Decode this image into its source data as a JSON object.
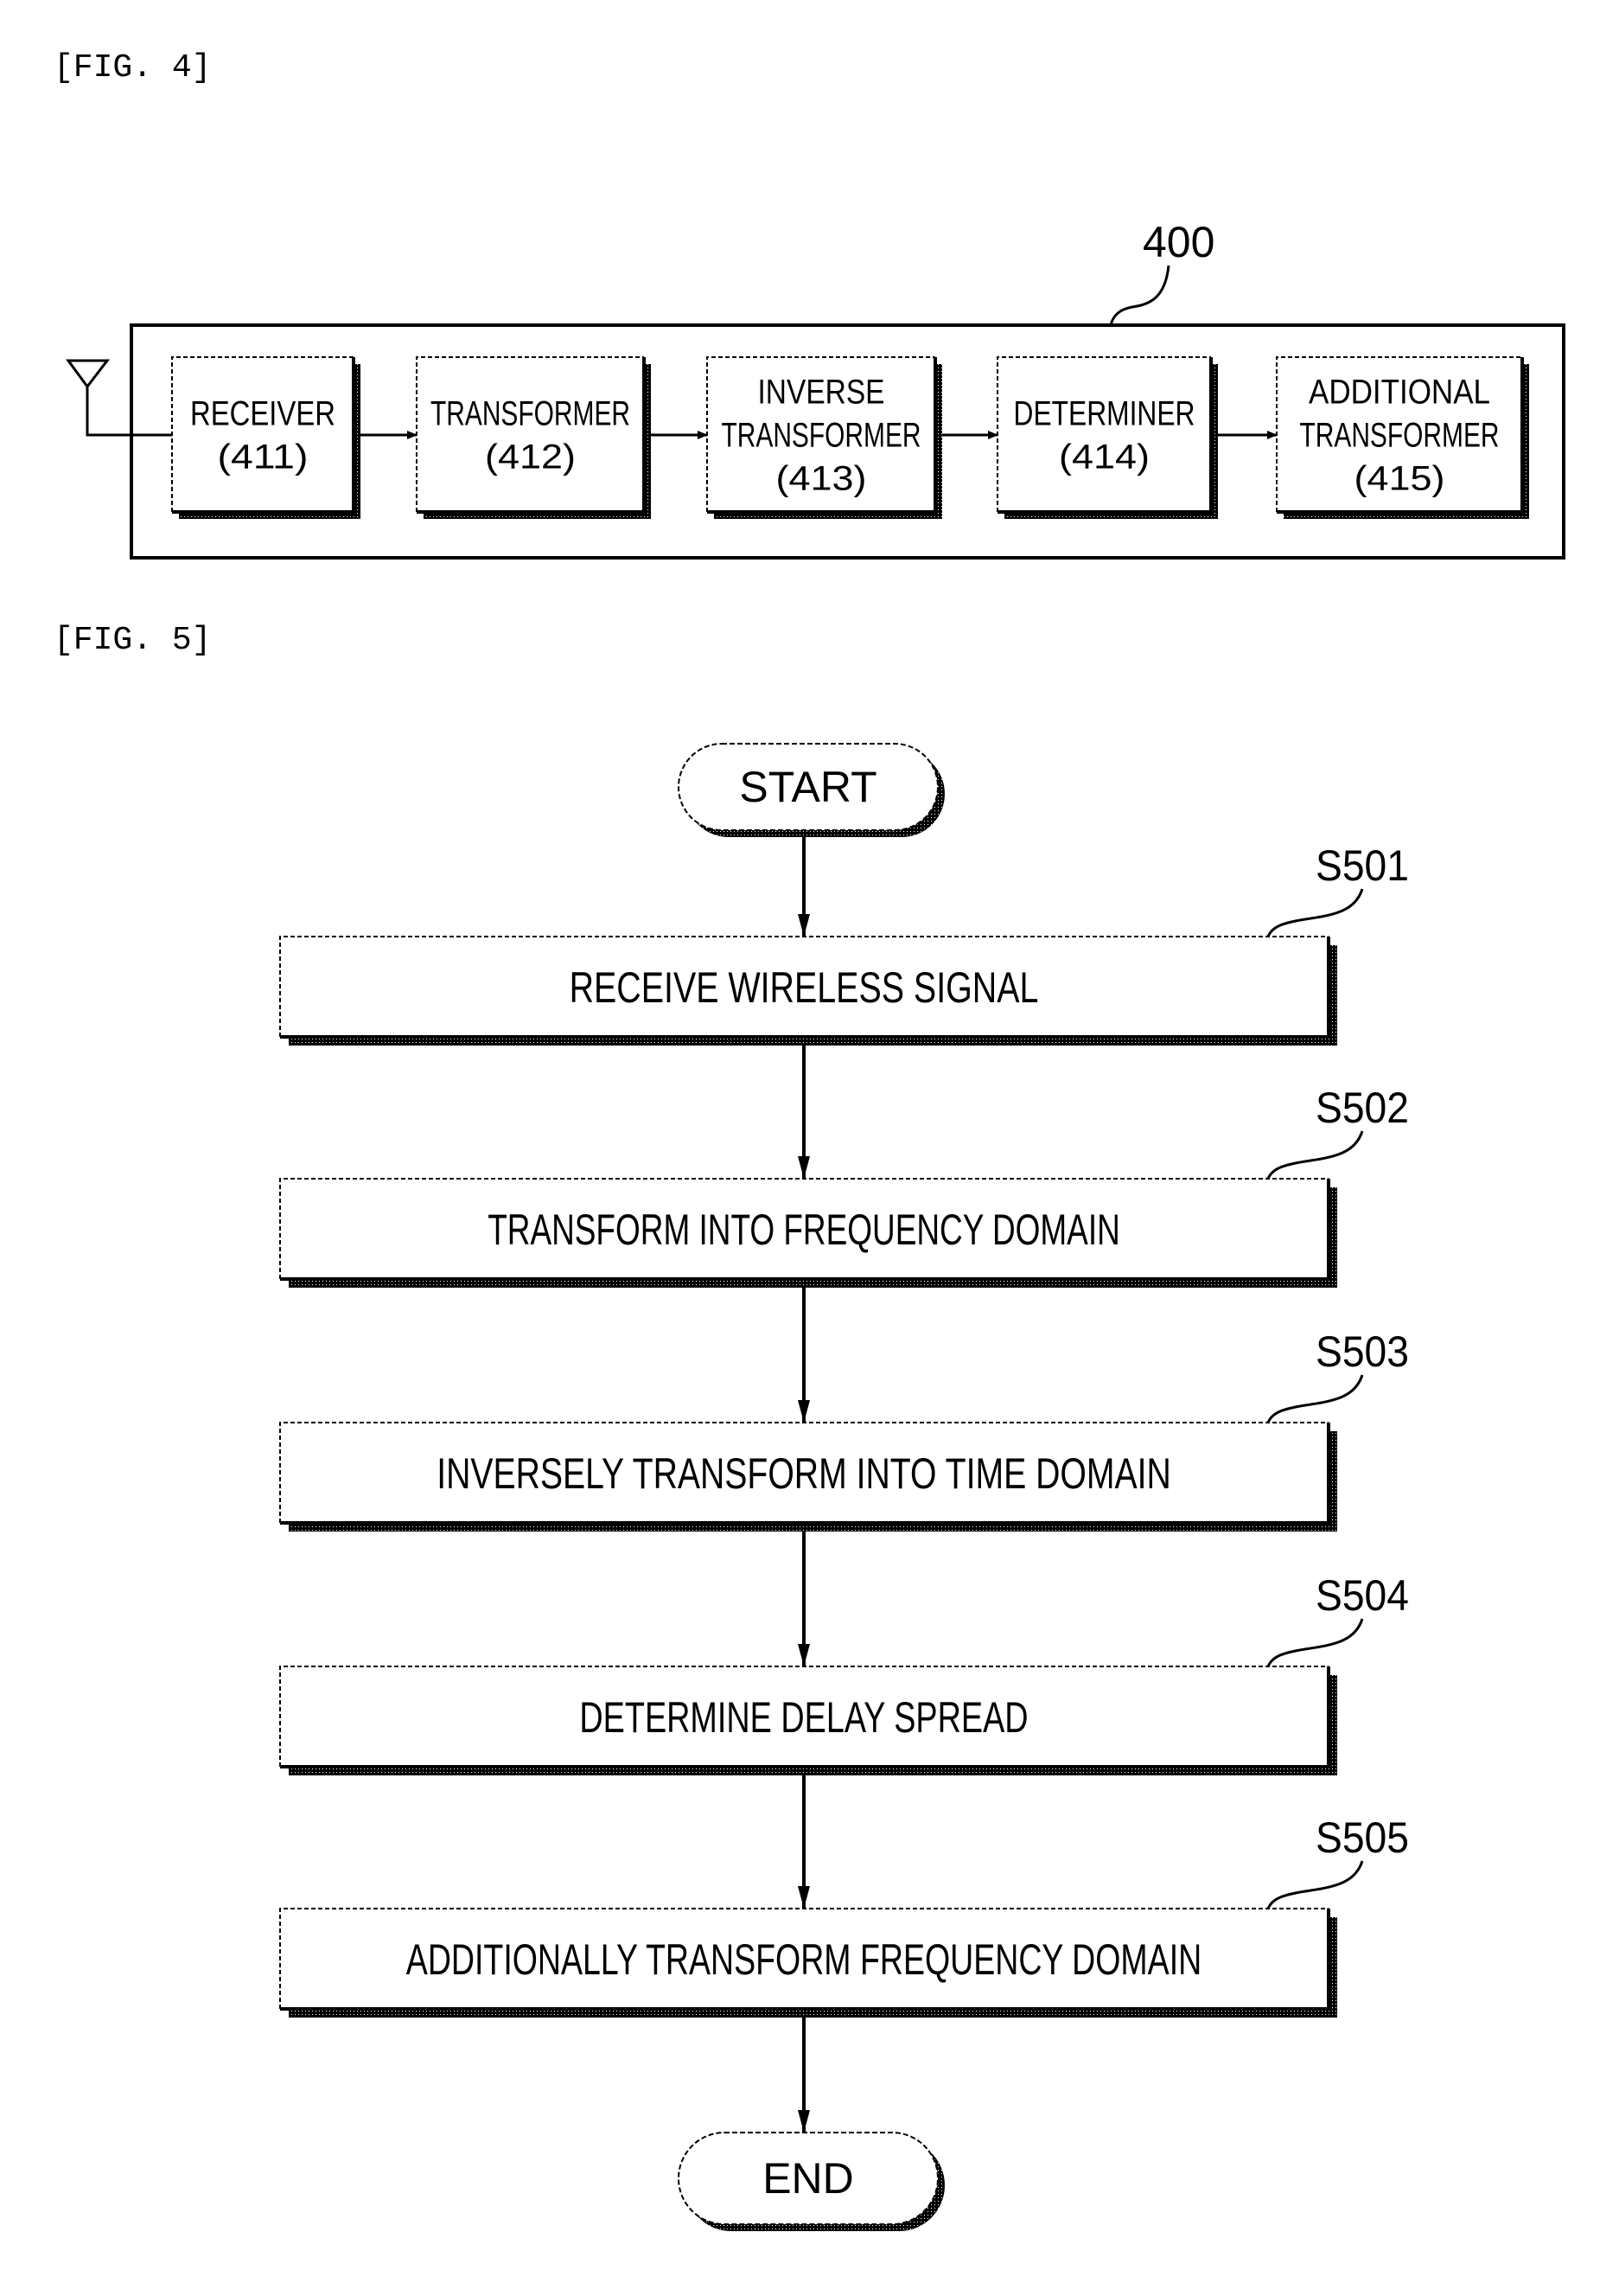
{
  "fig4": {
    "label": "[FIG. 4]",
    "reference": "400",
    "antenna_icon": "antenna-icon",
    "blocks": [
      {
        "lines": [
          "RECEIVER",
          "(411)"
        ],
        "id": "411"
      },
      {
        "lines": [
          "TRANSFORMER",
          "(412)"
        ],
        "id": "412"
      },
      {
        "lines": [
          "INVERSE",
          "TRANSFORMER",
          "(413)"
        ],
        "id": "413"
      },
      {
        "lines": [
          "DETERMINER",
          "(414)"
        ],
        "id": "414"
      },
      {
        "lines": [
          "ADDITIONAL",
          "TRANSFORMER",
          "(415)"
        ],
        "id": "415"
      }
    ]
  },
  "fig5": {
    "label": "[FIG. 5]",
    "start_label": "START",
    "end_label": "END",
    "steps": [
      {
        "ref": "S501",
        "text": "RECEIVE WIRELESS SIGNAL"
      },
      {
        "ref": "S502",
        "text": "TRANSFORM INTO FREQUENCY DOMAIN"
      },
      {
        "ref": "S503",
        "text": "INVERSELY TRANSFORM INTO TIME DOMAIN"
      },
      {
        "ref": "S504",
        "text": "DETERMINE DELAY SPREAD"
      },
      {
        "ref": "S505",
        "text": "ADDITIONALLY TRANSFORM FREQUENCY DOMAIN"
      }
    ]
  },
  "colors": {
    "ink": "#000000",
    "shadow": "#3a3a3a",
    "background": "#ffffff"
  }
}
